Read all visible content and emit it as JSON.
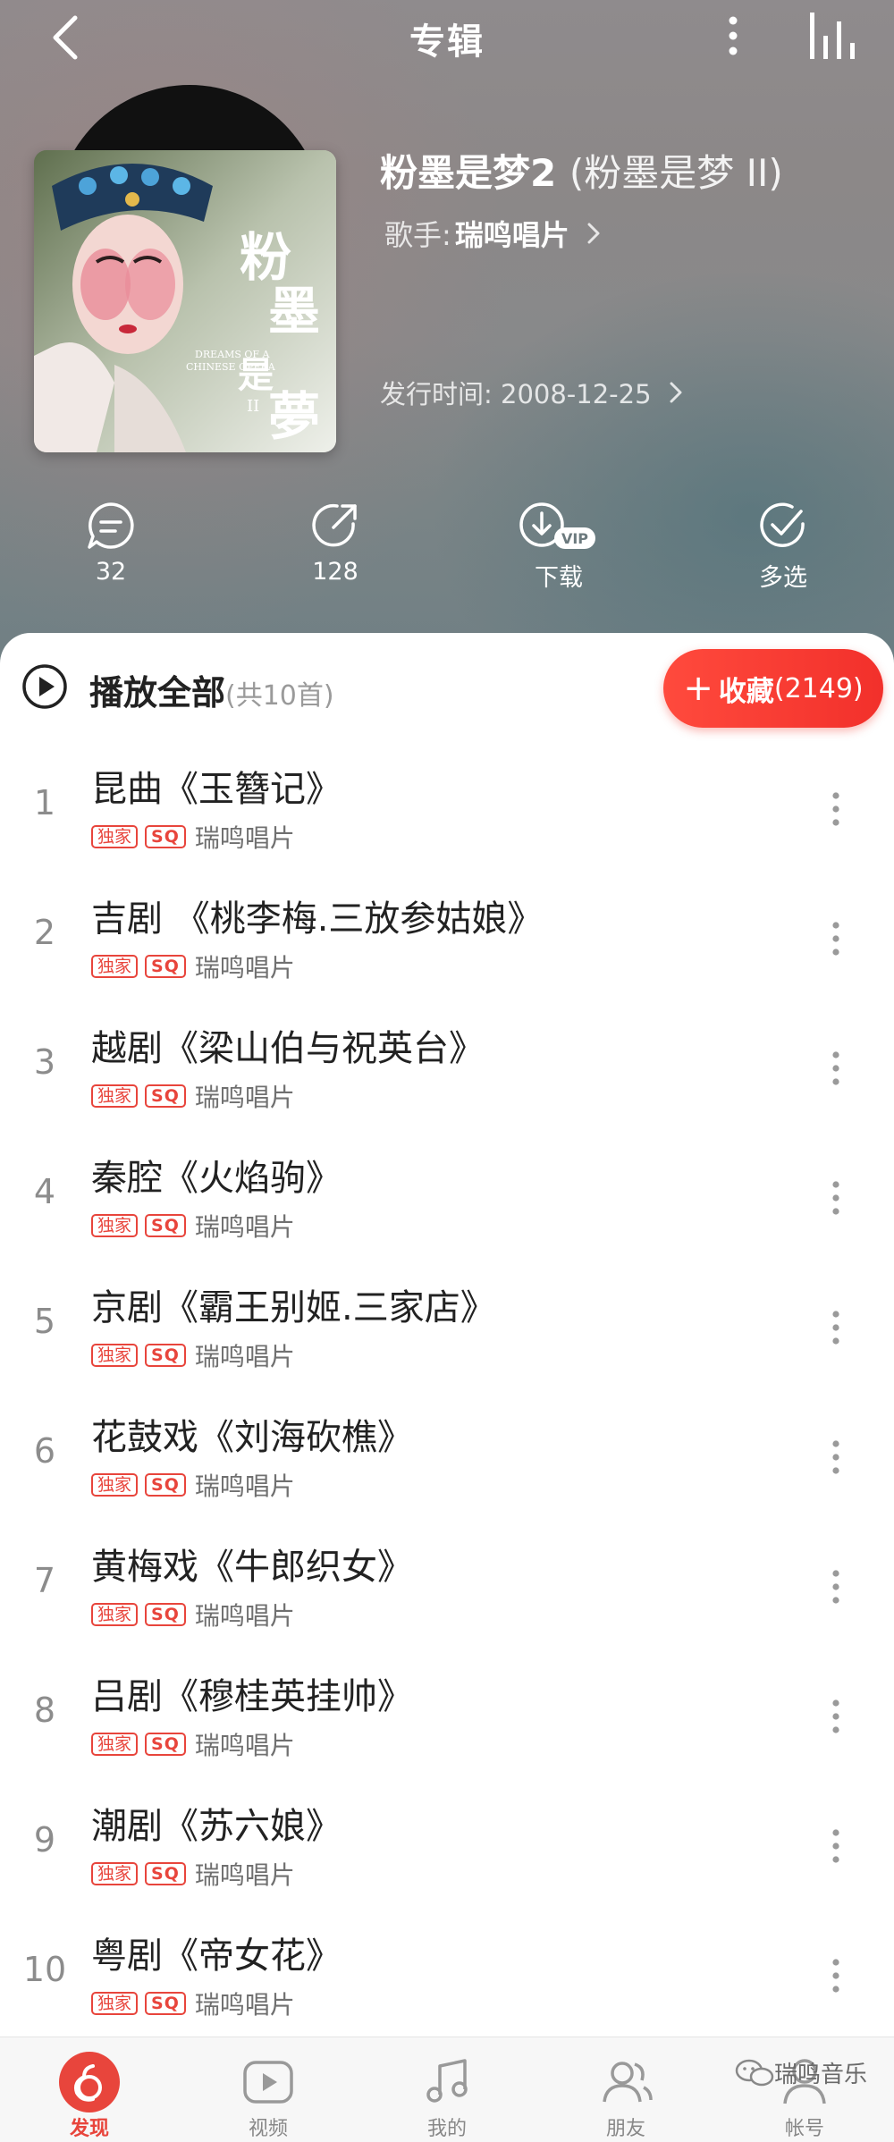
{
  "header": {
    "title": "专辑"
  },
  "album": {
    "name": "粉墨是梦2",
    "alt_name": "(粉墨是梦 II)",
    "artist_label": "歌手:",
    "artist_name": "瑞鸣唱片",
    "release_label": "发行时间: 2008-12-25",
    "cover_lettering": "粉墨是梦 II DREAMS OF A CHINESE OPERA"
  },
  "actions": {
    "comments_count": "32",
    "share_count": "128",
    "download_label": "下载",
    "download_badge": "VIP",
    "multiselect_label": "多选"
  },
  "list": {
    "play_all_label": "播放全部",
    "total_label": "(共10首)",
    "collect_label": "收藏",
    "collect_count": "(2149)",
    "badge_exclusive": "独家",
    "badge_sq": "SQ",
    "tracks": [
      {
        "num": "1",
        "title": "昆曲《玉簪记》",
        "artist": "瑞鸣唱片"
      },
      {
        "num": "2",
        "title": "吉剧 《桃李梅.三放参姑娘》",
        "artist": "瑞鸣唱片"
      },
      {
        "num": "3",
        "title": "越剧《梁山伯与祝英台》",
        "artist": "瑞鸣唱片"
      },
      {
        "num": "4",
        "title": "秦腔《火焰驹》",
        "artist": "瑞鸣唱片"
      },
      {
        "num": "5",
        "title": "京剧《霸王别姬.三家店》",
        "artist": "瑞鸣唱片"
      },
      {
        "num": "6",
        "title": "花鼓戏《刘海砍樵》",
        "artist": "瑞鸣唱片"
      },
      {
        "num": "7",
        "title": "黄梅戏《牛郎织女》",
        "artist": "瑞鸣唱片"
      },
      {
        "num": "8",
        "title": "吕剧《穆桂英挂帅》",
        "artist": "瑞鸣唱片"
      },
      {
        "num": "9",
        "title": "潮剧《苏六娘》",
        "artist": "瑞鸣唱片"
      },
      {
        "num": "10",
        "title": "粤剧《帝女花》",
        "artist": "瑞鸣唱片"
      }
    ]
  },
  "tabbar": {
    "items": [
      {
        "label": "发现",
        "icon": "discover-icon",
        "active": true
      },
      {
        "label": "视频",
        "icon": "video-icon",
        "active": false
      },
      {
        "label": "我的",
        "icon": "music-note-icon",
        "active": false
      },
      {
        "label": "朋友",
        "icon": "friends-icon",
        "active": false
      },
      {
        "label": "帐号",
        "icon": "account-icon",
        "active": false
      }
    ]
  },
  "watermark": "瑞鸣音乐",
  "colors": {
    "accent": "#e8453c",
    "collect_button": "#f2302b"
  }
}
